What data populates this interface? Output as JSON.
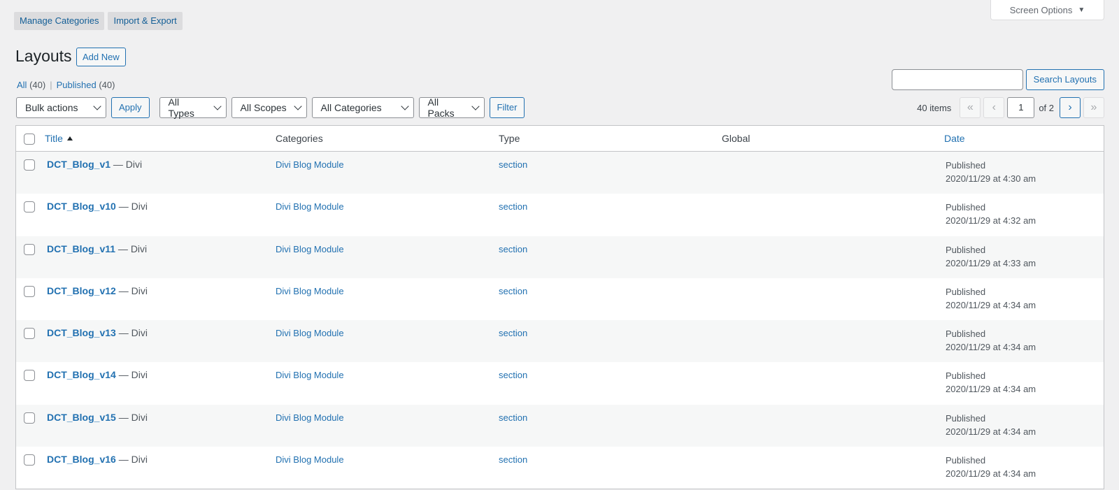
{
  "tabs": [
    "Manage Categories",
    "Import & Export"
  ],
  "screen_options": "Screen Options",
  "page_title": "Layouts",
  "add_new": "Add New",
  "views": {
    "all_label": "All",
    "all_count": "(40)",
    "separator": "|",
    "published_label": "Published",
    "published_count": "(40)"
  },
  "search": {
    "button": "Search Layouts",
    "value": ""
  },
  "filters": {
    "bulk_actions": "Bulk actions",
    "apply": "Apply",
    "types": "All Types",
    "scopes": "All Scopes",
    "categories": "All Categories",
    "packs": "All Packs",
    "filter": "Filter"
  },
  "pagination": {
    "items": "40 items",
    "first": "«",
    "prev": "‹",
    "current": "1",
    "of": "of 2",
    "next": "›",
    "last": "»"
  },
  "columns": {
    "title": "Title",
    "categories": "Categories",
    "type": "Type",
    "global": "Global",
    "date": "Date"
  },
  "rows": [
    {
      "title": "DCT_Blog_v1",
      "state": " — Divi",
      "category": "Divi Blog Module",
      "type": "section",
      "global": "",
      "status": "Published",
      "date": "2020/11/29 at 4:30 am"
    },
    {
      "title": "DCT_Blog_v10",
      "state": " — Divi",
      "category": "Divi Blog Module",
      "type": "section",
      "global": "",
      "status": "Published",
      "date": "2020/11/29 at 4:32 am"
    },
    {
      "title": "DCT_Blog_v11",
      "state": " — Divi",
      "category": "Divi Blog Module",
      "type": "section",
      "global": "",
      "status": "Published",
      "date": "2020/11/29 at 4:33 am"
    },
    {
      "title": "DCT_Blog_v12",
      "state": " — Divi",
      "category": "Divi Blog Module",
      "type": "section",
      "global": "",
      "status": "Published",
      "date": "2020/11/29 at 4:34 am"
    },
    {
      "title": "DCT_Blog_v13",
      "state": " — Divi",
      "category": "Divi Blog Module",
      "type": "section",
      "global": "",
      "status": "Published",
      "date": "2020/11/29 at 4:34 am"
    },
    {
      "title": "DCT_Blog_v14",
      "state": " — Divi",
      "category": "Divi Blog Module",
      "type": "section",
      "global": "",
      "status": "Published",
      "date": "2020/11/29 at 4:34 am"
    },
    {
      "title": "DCT_Blog_v15",
      "state": " — Divi",
      "category": "Divi Blog Module",
      "type": "section",
      "global": "",
      "status": "Published",
      "date": "2020/11/29 at 4:34 am"
    },
    {
      "title": "DCT_Blog_v16",
      "state": " — Divi",
      "category": "Divi Blog Module",
      "type": "section",
      "global": "",
      "status": "Published",
      "date": "2020/11/29 at 4:34 am"
    }
  ]
}
